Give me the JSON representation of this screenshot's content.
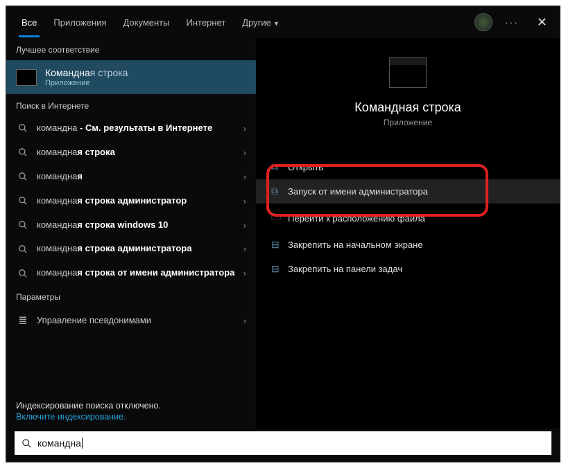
{
  "header": {
    "tabs": [
      {
        "label": "Все",
        "active": true
      },
      {
        "label": "Приложения",
        "active": false
      },
      {
        "label": "Документы",
        "active": false
      },
      {
        "label": "Интернет",
        "active": false
      },
      {
        "label": "Другие",
        "active": false,
        "chevron": true
      }
    ]
  },
  "sections": {
    "best_match": "Лучшее соответствие",
    "web": "Поиск в Интернете",
    "settings": "Параметры"
  },
  "best_match": {
    "title_prefix": "Командна",
    "title_suffix": "я строка",
    "subtitle": "Приложение"
  },
  "web_results": [
    {
      "prefix": "командна",
      "suffix": " - См. результаты в Интернете"
    },
    {
      "prefix": "командна",
      "suffix": "я строка"
    },
    {
      "prefix": "командна",
      "suffix": "я"
    },
    {
      "prefix": "командна",
      "suffix": "я строка администратор"
    },
    {
      "prefix": "командна",
      "suffix": "я строка windows 10"
    },
    {
      "prefix": "командна",
      "suffix": "я строка администратора"
    },
    {
      "prefix": "командна",
      "suffix": "я строка от имени администратора"
    }
  ],
  "settings_result": {
    "label": "Управление псевдонимами"
  },
  "notice": {
    "line1": "Индексирование поиска отключено.",
    "line2": "Включите индексирование."
  },
  "preview": {
    "title": "Командная строка",
    "subtitle": "Приложение",
    "actions": [
      {
        "label": "Открыть",
        "highlight": false
      },
      {
        "label": "Запуск от имени администратора",
        "highlight": true
      },
      {
        "label": "Перейти к расположению файла",
        "highlight": false
      },
      {
        "label": "Закрепить на начальном экране",
        "highlight": false
      },
      {
        "label": "Закрепить на панели задач",
        "highlight": false
      }
    ]
  },
  "search": {
    "value": "командна"
  }
}
